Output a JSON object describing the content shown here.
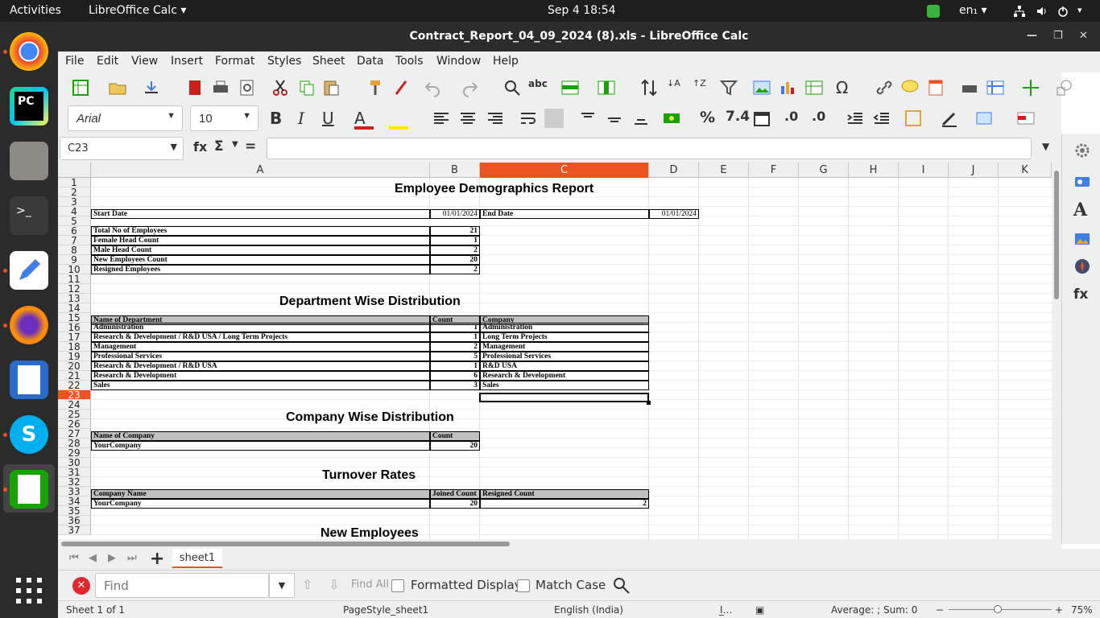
{
  "topbar": {
    "activities": "Activities",
    "app": "LibreOffice Calc ▾",
    "clock": "Sep 4  18:54",
    "lang": "en₁ ▾"
  },
  "window": {
    "title": "Contract_Report_04_09_2024 (8).xls - LibreOffice Calc"
  },
  "menu": [
    "File",
    "Edit",
    "View",
    "Insert",
    "Format",
    "Styles",
    "Sheet",
    "Data",
    "Tools",
    "Window",
    "Help"
  ],
  "font": {
    "name": "Arial",
    "size": "10"
  },
  "namebox": "C23",
  "formula_symbols": {
    "fx": "fx",
    "sum": "Σ",
    "eq": "="
  },
  "columns": [
    "A",
    "B",
    "C",
    "D",
    "E",
    "F",
    "G",
    "H",
    "I",
    "J",
    "K"
  ],
  "rows": [
    "1",
    "2",
    "3",
    "4",
    "5",
    "6",
    "7",
    "8",
    "9",
    "10",
    "11",
    "12",
    "13",
    "14",
    "15",
    "16",
    "17",
    "18",
    "19",
    "20",
    "21",
    "22",
    "23",
    "24",
    "25",
    "26",
    "27",
    "28",
    "29",
    "30",
    "31",
    "32",
    "33",
    "34",
    "35",
    "36",
    "37"
  ],
  "report": {
    "title": "Employee Demographics Report",
    "start_label": "Start Date",
    "start_value": "01/01/2024",
    "end_label": "End Date",
    "end_value": "01/01/2024",
    "summary": [
      {
        "label": "Total No of Employees",
        "value": "21"
      },
      {
        "label": "Female Head Count",
        "value": "1"
      },
      {
        "label": "Male Head Count",
        "value": "2"
      },
      {
        "label": "New Employees Count",
        "value": "20"
      },
      {
        "label": "Resigned Employees",
        "value": "2"
      }
    ],
    "dept_title": "Department Wise Distribution",
    "dept_headers": [
      "Name of Department",
      "Count",
      "Company"
    ],
    "dept_rows": [
      [
        "Administration",
        "1",
        "Administration"
      ],
      [
        "Research & Development / R&D USA / Long Term Projects",
        "1",
        "Long Term Projects"
      ],
      [
        "Management",
        "2",
        "Management"
      ],
      [
        "Professional Services",
        "5",
        "Professional Services"
      ],
      [
        "Research & Development / R&D USA",
        "1",
        "R&D USA"
      ],
      [
        "Research & Development",
        "6",
        "Research & Development"
      ],
      [
        "Sales",
        "3",
        "Sales"
      ]
    ],
    "company_title": "Company Wise Distribution",
    "company_headers": [
      "Name of Company",
      "Count"
    ],
    "company_rows": [
      [
        "YourCompany",
        "20"
      ]
    ],
    "turnover_title": "Turnover Rates",
    "turnover_headers": [
      "Company Name",
      "Joined Count",
      "Resigned Count"
    ],
    "turnover_rows": [
      [
        "YourCompany",
        "20",
        "2"
      ]
    ],
    "new_title": "New Employees"
  },
  "sheet_tab": "sheet1",
  "find": {
    "placeholder": "Find",
    "find_all": "Find All",
    "formatted": "Formatted Display",
    "match_case": "Match Case"
  },
  "status": {
    "sheet": "Sheet 1 of 1",
    "pagestyle": "PageStyle_sheet1",
    "language": "English (India)",
    "summary": "Average: ; Sum: 0",
    "zoom": "75%"
  }
}
